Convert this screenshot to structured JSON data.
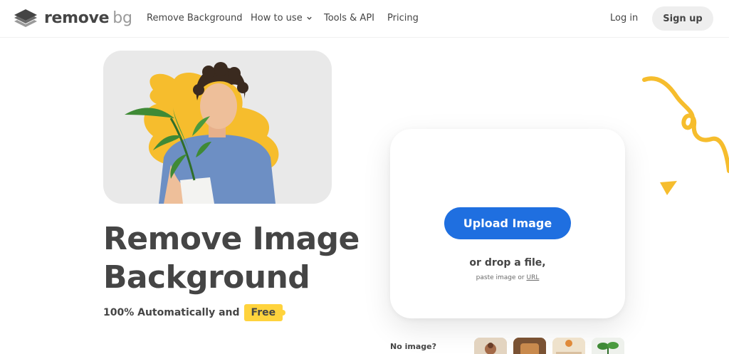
{
  "header": {
    "logo": {
      "word1": "remove",
      "word2": "bg"
    },
    "nav": [
      {
        "label": "Remove Background"
      },
      {
        "label": "How to use"
      },
      {
        "label": "Tools & API"
      },
      {
        "label": "Pricing"
      }
    ],
    "login_label": "Log in",
    "signup_label": "Sign up"
  },
  "hero": {
    "title_line1": "Remove Image",
    "title_line2": "Background",
    "subtitle": "100% Automatically and",
    "free_badge": "Free"
  },
  "upload": {
    "button_label": "Upload Image",
    "drop_text": "or drop a file,",
    "paste_prefix": "paste image or",
    "url_label": "URL"
  },
  "samples": {
    "label": "No image?"
  },
  "colors": {
    "accent_blue": "#1f6fe0",
    "accent_yellow": "#ffd33d",
    "text_dark": "#454545"
  },
  "icons": {
    "logo": "layers-icon",
    "chevron": "chevron-down-icon"
  }
}
